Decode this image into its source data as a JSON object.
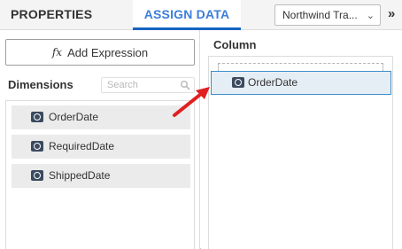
{
  "header": {
    "tabs": [
      {
        "label": "PROPERTIES",
        "active": false
      },
      {
        "label": "ASSIGN DATA",
        "active": true
      }
    ],
    "datasource": {
      "value": "Northwind Tra...",
      "chevron": "chevron-down-icon"
    },
    "collapse_icon": "double-chevron-right-icon"
  },
  "left": {
    "add_expression_icon": "fx",
    "add_expression_label": "Add Expression",
    "dimensions_title": "Dimensions",
    "search_placeholder": "Search",
    "items": [
      {
        "label": "OrderDate",
        "icon": "date-field-icon"
      },
      {
        "label": "RequiredDate",
        "icon": "date-field-icon"
      },
      {
        "label": "ShippedDate",
        "icon": "date-field-icon"
      }
    ]
  },
  "right": {
    "column_title": "Column",
    "items": [
      {
        "label": "OrderDate",
        "icon": "date-field-icon"
      }
    ]
  },
  "colors": {
    "accent": "#1565c0",
    "active_tab_text": "#3b7fd9",
    "arrow": "#e02020",
    "selected_border": "#3d8fc9"
  }
}
